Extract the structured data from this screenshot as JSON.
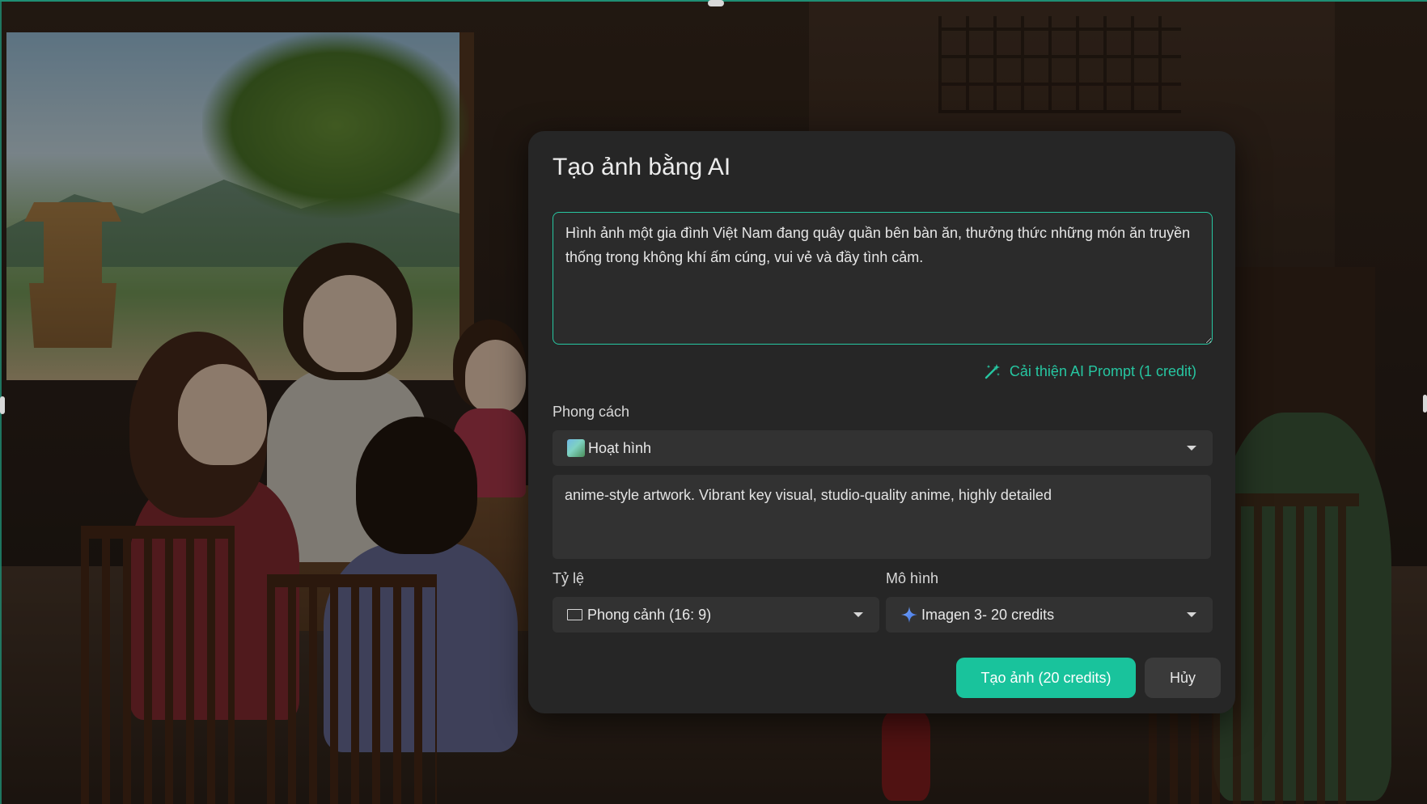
{
  "dialog": {
    "title": "Tạo ảnh bằng AI",
    "prompt_value": "Hình ảnh một gia đình Việt Nam đang quây quần bên bàn ăn, thưởng thức những món ăn truyền thống trong không khí ấm cúng, vui vẻ và đầy tình cảm.",
    "improve_prompt_label": "Cải thiện AI Prompt (1 credit)",
    "style": {
      "label": "Phong cách",
      "selected": "Hoạt hình",
      "description": "anime-style artwork. Vibrant key visual, studio-quality anime, highly detailed"
    },
    "ratio": {
      "label": "Tỷ lệ",
      "selected": "Phong cảnh (16: 9)"
    },
    "model": {
      "label": "Mô hình",
      "selected": "Imagen 3- 20 credits"
    },
    "buttons": {
      "create": "Tạo ảnh (20 credits)",
      "cancel": "Hủy"
    }
  },
  "colors": {
    "accent": "#19c39c",
    "modal_bg": "#262626",
    "field_bg": "#323232"
  },
  "icons": {
    "improve": "magic-wand-icon",
    "style": "style-thumbnail-icon",
    "ratio": "landscape-frame-icon",
    "model": "sparkle-icon",
    "dropdown": "chevron-down-icon"
  }
}
